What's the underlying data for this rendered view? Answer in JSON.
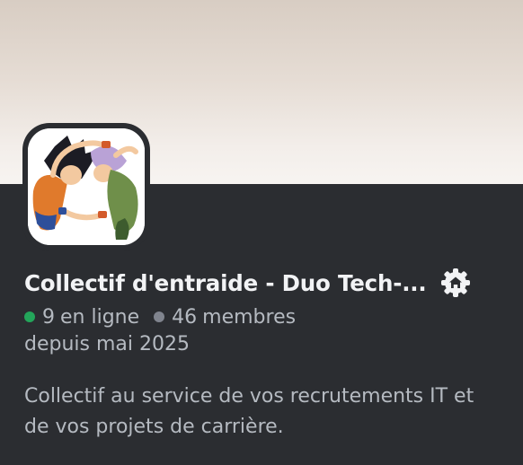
{
  "server": {
    "name": "Collectif d'entraide - Duo Tech-...",
    "badge_icon": "community-gear-home-icon",
    "online_count": "9",
    "online_label": "en ligne",
    "online_color": "#23a55a",
    "member_count": "46",
    "member_label": "membres",
    "member_color": "#80848e",
    "since": "depuis mai 2025",
    "description": "Collectif au service de vos recrutements IT et de vos projets de carrière.",
    "avatar_icon": "anime-characters-avatar"
  },
  "colors": {
    "card_background": "#2b2d31",
    "title_text": "#f2f3f5",
    "secondary_text": "#b5bac1"
  }
}
